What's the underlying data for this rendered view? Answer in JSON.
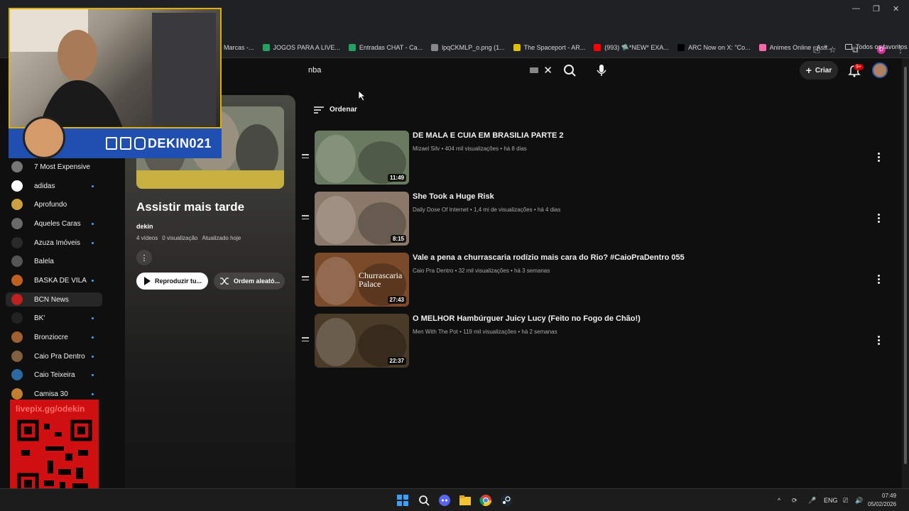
{
  "browser": {
    "bookmarks": [
      {
        "label": "Marcas -...",
        "color": "#4a4a4a"
      },
      {
        "label": "JOGOS PARA A LIVE...",
        "color": "#21a366"
      },
      {
        "label": "Entradas CHAT - Ca...",
        "color": "#21a366"
      },
      {
        "label": "lpqCKMLP_o.png (1...",
        "color": "#888888"
      },
      {
        "label": "The Spaceport - AR...",
        "color": "#e0c000"
      },
      {
        "label": "(993) 🛸*NEW* EXA...",
        "color": "#ff0000"
      },
      {
        "label": "ARC Now on X: \"Co...",
        "color": "#000000"
      },
      {
        "label": "Animes Online - Ass...",
        "color": "#ff66aa"
      }
    ],
    "all_bookmarks": "Todos os favoritos"
  },
  "header": {
    "search_value": "nba",
    "create_label": "Criar",
    "notif_badge": "9+"
  },
  "sidebar": {
    "items": [
      {
        "label": "7 Most Expensive",
        "color": "#777777",
        "dot": false
      },
      {
        "label": "adidas",
        "color": "#ffffff",
        "dot": true
      },
      {
        "label": "Aprofundo",
        "color": "#c8a040",
        "dot": false
      },
      {
        "label": "Aqueles Caras",
        "color": "#6a6a6a",
        "dot": true
      },
      {
        "label": "Azuza Imóveis",
        "color": "#2a2a2a",
        "dot": true
      },
      {
        "label": "Balela",
        "color": "#555555",
        "dot": false
      },
      {
        "label": "BASKA DE VILA",
        "color": "#c06020",
        "dot": true
      },
      {
        "label": "BCN News",
        "color": "#c02020",
        "dot": false
      },
      {
        "label": "BK'",
        "color": "#222222",
        "dot": true
      },
      {
        "label": "Bronziocre",
        "color": "#a06030",
        "dot": true
      },
      {
        "label": "Caio Pra Dentro",
        "color": "#806040",
        "dot": true
      },
      {
        "label": "Caio Teixeira",
        "color": "#2a6aa0",
        "dot": true
      },
      {
        "label": "Camisa 30",
        "color": "#c08030",
        "dot": true
      }
    ]
  },
  "playlist": {
    "title": "Assistir mais tarde",
    "owner": "dekin",
    "video_count": "4 vídeos",
    "views": "0 visualização",
    "updated": "Atualizado hoje",
    "play_label": "Reproduzir tu...",
    "shuffle_label": "Ordem aleató..."
  },
  "sort_label": "Ordenar",
  "videos": [
    {
      "title": "DE MALA E CUIA EM BRASILIA PARTE 2",
      "meta": "Mizael Silv • 404 mil visualizações • há 8 dias",
      "duration": "11:49",
      "bg": "#6a7a60"
    },
    {
      "title": "She Took a Huge Risk",
      "meta": "Daily Dose Of Internet • 1,4 mi de visualizações • há 4 dias",
      "duration": "8:15",
      "bg": "#8a7868"
    },
    {
      "title": "Vale a pena a churrascaria rodízio mais cara do Rio? #CaioPraDentro 055",
      "meta": "Caio Pra Dentro • 32 mil visualizações • há 3 semanas",
      "duration": "27:43",
      "bg": "#7a4a2a",
      "overlay": "Churrascaria Palace"
    },
    {
      "title": "O MELHOR Hambúrguer Juicy Lucy (Feito no Fogo de Chão!)",
      "meta": "Men With The Pot • 119 mil visualizações • há 2 semanas",
      "duration": "22:37",
      "bg": "#4a3a28"
    }
  ],
  "overlay": {
    "social_handle": "DEKIN021",
    "qr_text": "livepix.gg/odekin"
  },
  "taskbar": {
    "lang": "ENG",
    "time": "07:49",
    "date": "05/02/2026"
  }
}
